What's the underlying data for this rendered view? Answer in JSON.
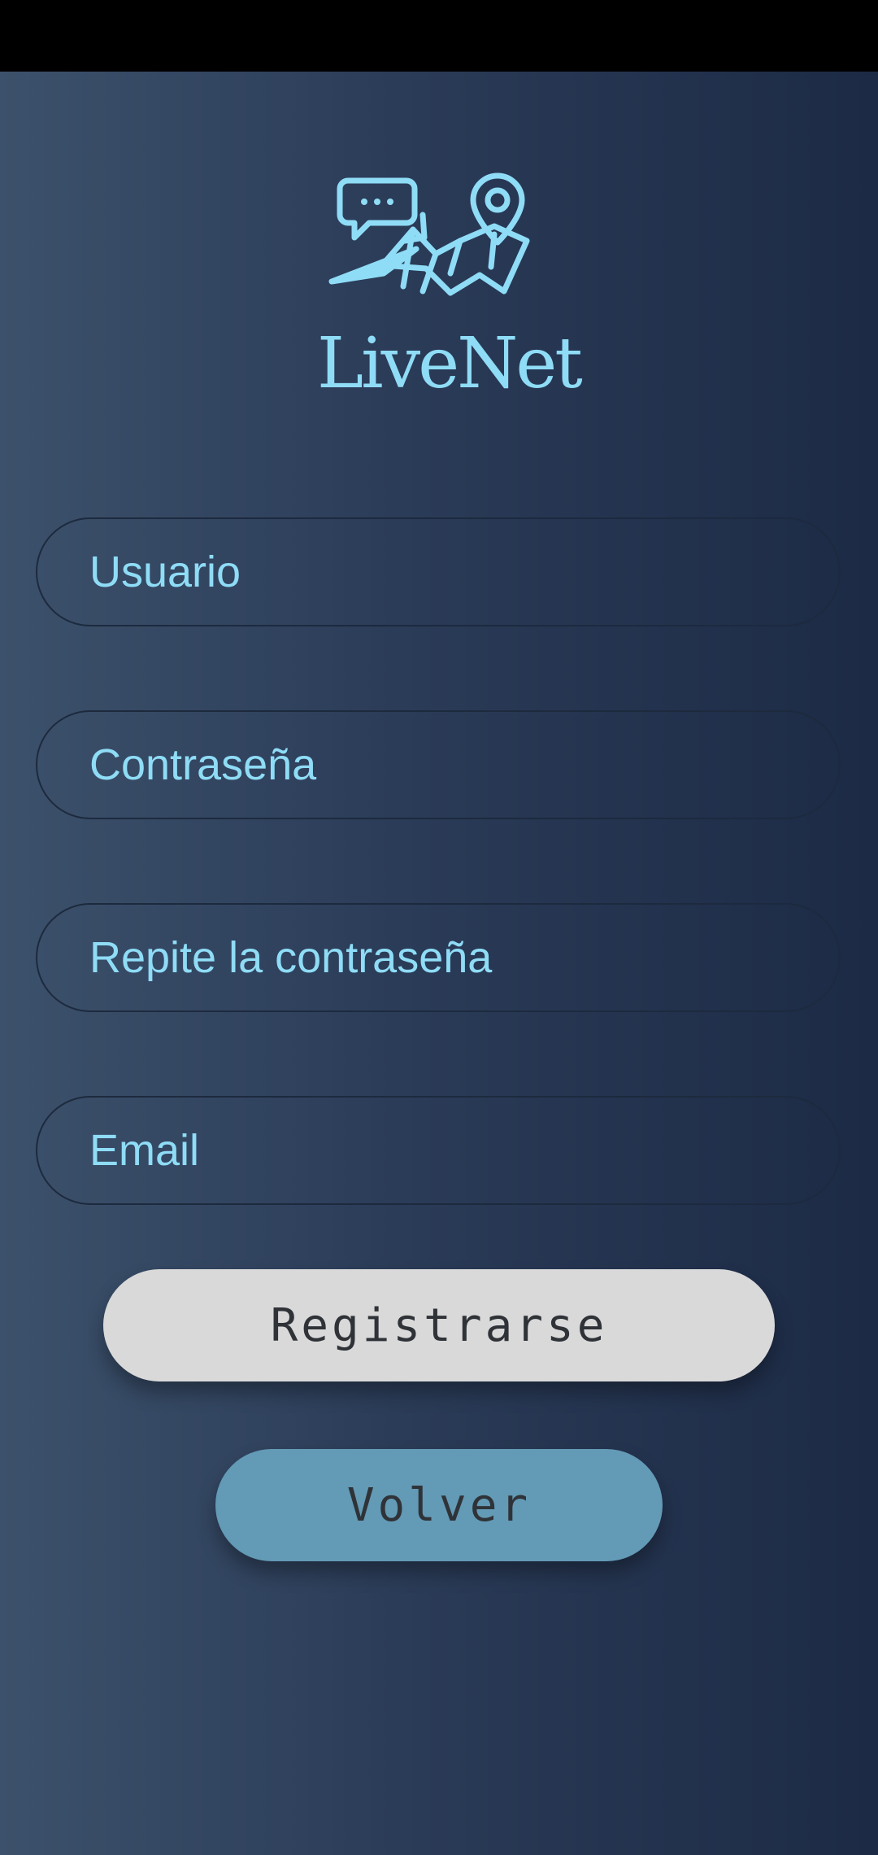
{
  "app": {
    "name": "LiveNet"
  },
  "colors": {
    "accent": "#8fdcf6",
    "register_button_bg": "#d9d9d9",
    "back_button_bg": "#639ab6",
    "button_text": "#2f3338"
  },
  "logo": {
    "icon_names": [
      "chat-bubble-icon",
      "folded-map-icon",
      "location-pin-icon",
      "paper-plane-icon"
    ]
  },
  "form": {
    "username": {
      "placeholder": "Usuario",
      "value": ""
    },
    "password": {
      "placeholder": "Contraseña",
      "value": ""
    },
    "repeat_password": {
      "placeholder": "Repite la contraseña",
      "value": ""
    },
    "email": {
      "placeholder": "Email",
      "value": ""
    }
  },
  "actions": {
    "register_label": "Registrarse",
    "back_label": "Volver"
  }
}
